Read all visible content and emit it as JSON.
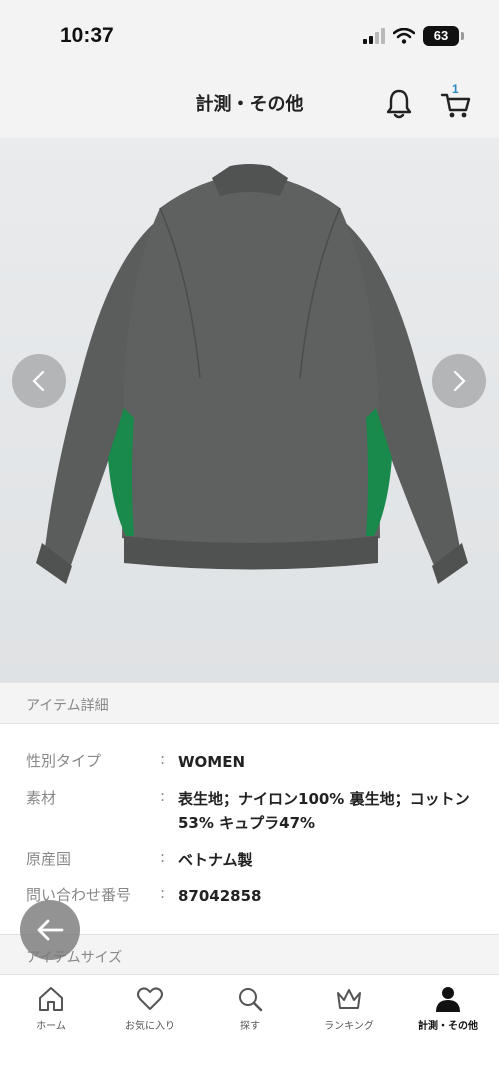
{
  "status_bar": {
    "time": "10:37",
    "battery": "63"
  },
  "header": {
    "title": "計測・その他",
    "cart_count": "1"
  },
  "item_detail": {
    "section_title": "アイテム詳細",
    "rows": [
      {
        "label": "性別タイプ",
        "colon": ":",
        "value": "WOMEN"
      },
      {
        "label": "素材",
        "colon": ":",
        "value": "表生地；ナイロン100% 裏生地；コットン53% キュプラ47%"
      },
      {
        "label": "原産国",
        "colon": ":",
        "value": "ベトナム製"
      },
      {
        "label": "問い合わせ番号",
        "colon": ":",
        "value": "87042858"
      }
    ]
  },
  "item_size": {
    "section_title": "アイテムサイズ"
  },
  "bottom_nav": {
    "items": [
      {
        "label": "ホーム",
        "icon": "home-icon"
      },
      {
        "label": "お気に入り",
        "icon": "heart-icon"
      },
      {
        "label": "探す",
        "icon": "search-icon"
      },
      {
        "label": "ランキング",
        "icon": "crown-icon"
      },
      {
        "label": "計測・その他",
        "icon": "person-icon"
      }
    ]
  },
  "colors": {
    "jacket_gray": "#5a5d5c",
    "accent_green": "#1a8a4c",
    "cart_badge": "#2a8ac8",
    "background_gray": "#f3f3f3"
  }
}
